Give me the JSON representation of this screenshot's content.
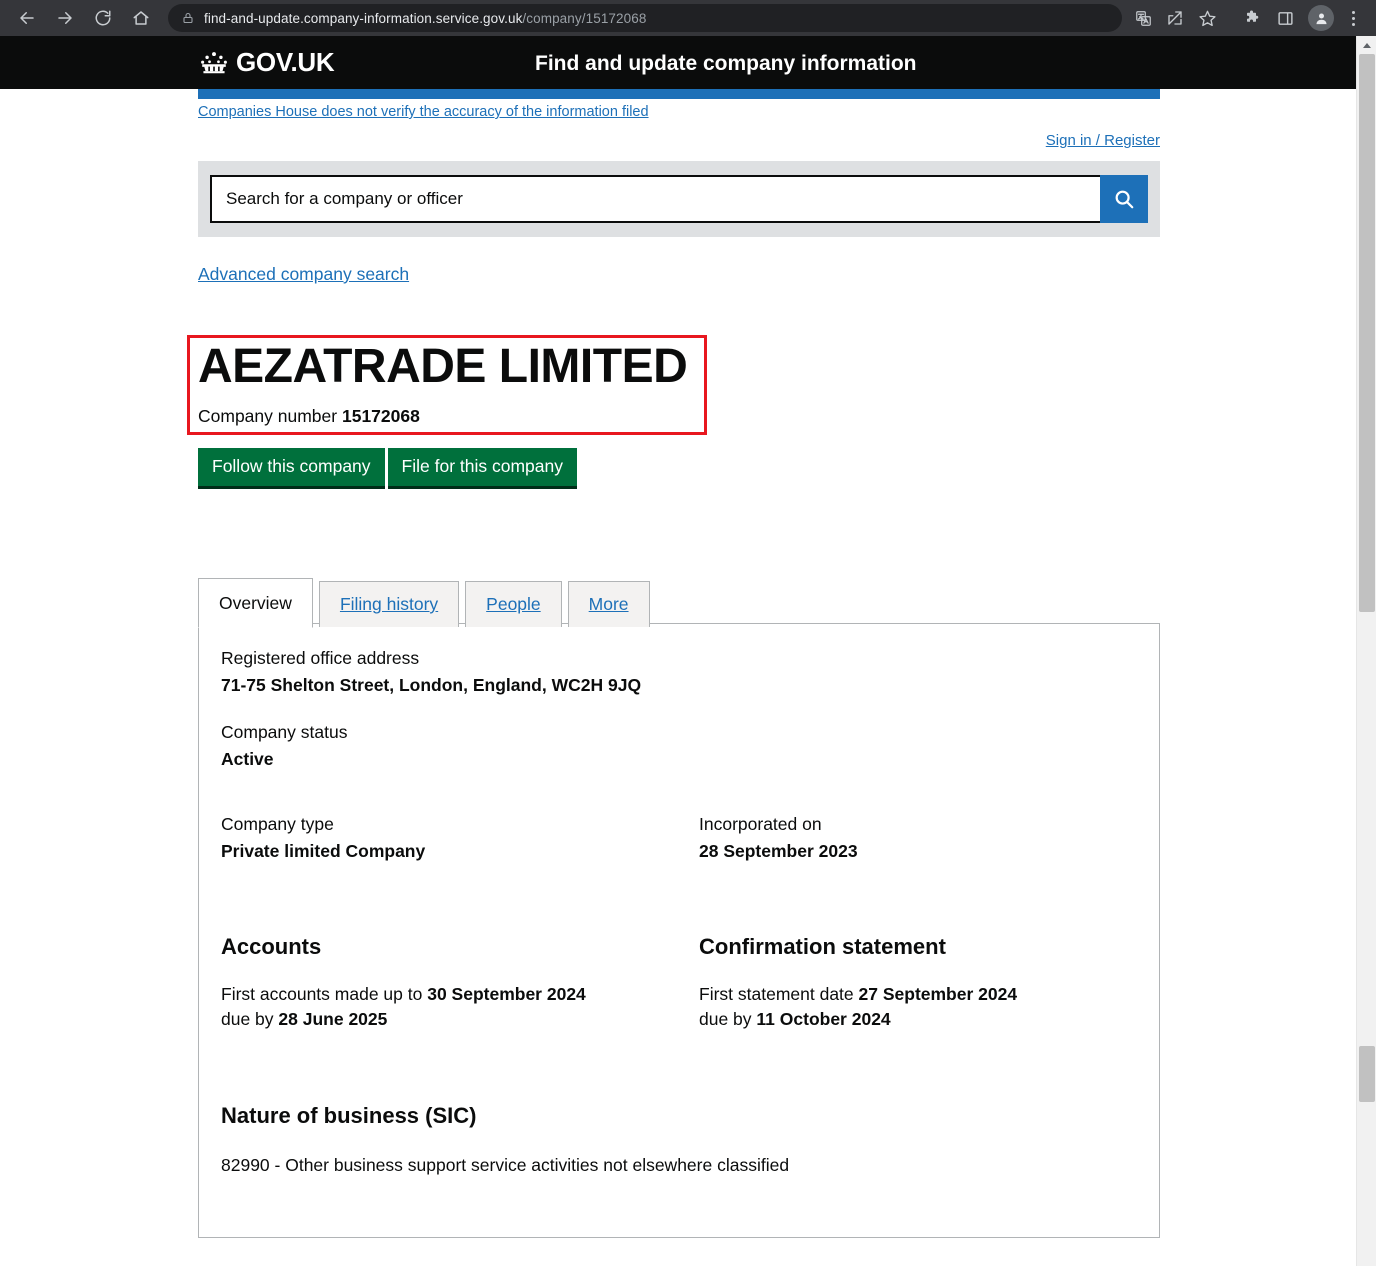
{
  "browser": {
    "url_domain": "find-and-update.company-information.service.gov.uk",
    "url_path": "/company/15172068",
    "back_icon": "back-arrow-icon",
    "forward_icon": "forward-arrow-icon",
    "reload_icon": "reload-icon",
    "home_icon": "home-icon",
    "lock_icon": "lock-icon",
    "translate_icon": "translate-icon",
    "share_icon": "share-icon",
    "bookmark_icon": "bookmark-star-icon",
    "extensions_icon": "extensions-puzzle-icon",
    "sidepanel_icon": "side-panel-icon",
    "profile_icon": "profile-avatar-icon",
    "menu_icon": "three-dot-menu-icon"
  },
  "header": {
    "logo_text": "GOV.UK",
    "crown_icon": "crown-icon",
    "service_name": "Find and update company information",
    "disclaimer": "Companies House does not verify the accuracy of the information filed",
    "signin": "Sign in / Register"
  },
  "search": {
    "placeholder": "Search for a company or officer",
    "value": "",
    "submit_icon": "search-icon",
    "advanced_link": "Advanced company search"
  },
  "company": {
    "name": "AEZATRADE LIMITED",
    "number_label": "Company number",
    "number": "15172068",
    "follow_button": "Follow this company",
    "file_button": "File for this company"
  },
  "tabs": [
    {
      "label": "Overview",
      "active": true
    },
    {
      "label": "Filing history",
      "active": false
    },
    {
      "label": "People",
      "active": false
    },
    {
      "label": "More",
      "active": false
    }
  ],
  "overview": {
    "registered_office_label": "Registered office address",
    "registered_office_value": "71-75 Shelton Street, London, England, WC2H 9JQ",
    "status_label": "Company status",
    "status_value": "Active",
    "type_label": "Company type",
    "type_value": "Private limited Company",
    "incorporated_label": "Incorporated on",
    "incorporated_value": "28 September 2023",
    "accounts_heading": "Accounts",
    "accounts_line1_prefix": "First accounts made up to ",
    "accounts_line1_date": "30 September 2024",
    "accounts_line2_prefix": "due by ",
    "accounts_line2_date": "28 June 2025",
    "confirmation_heading": "Confirmation statement",
    "confirmation_line1_prefix": "First statement date ",
    "confirmation_line1_date": "27 September 2024",
    "confirmation_line2_prefix": "due by ",
    "confirmation_line2_date": "11 October 2024",
    "sic_heading": "Nature of business (SIC)",
    "sic_value": "82990 - Other business support service activities not elsewhere classified"
  },
  "colors": {
    "govuk_black": "#0b0c0c",
    "govuk_blue": "#1d70b8",
    "govuk_green": "#00703c",
    "highlight_red": "#e8171f",
    "search_band_grey": "#dee0e2",
    "tab_grey": "#f3f2f1"
  }
}
